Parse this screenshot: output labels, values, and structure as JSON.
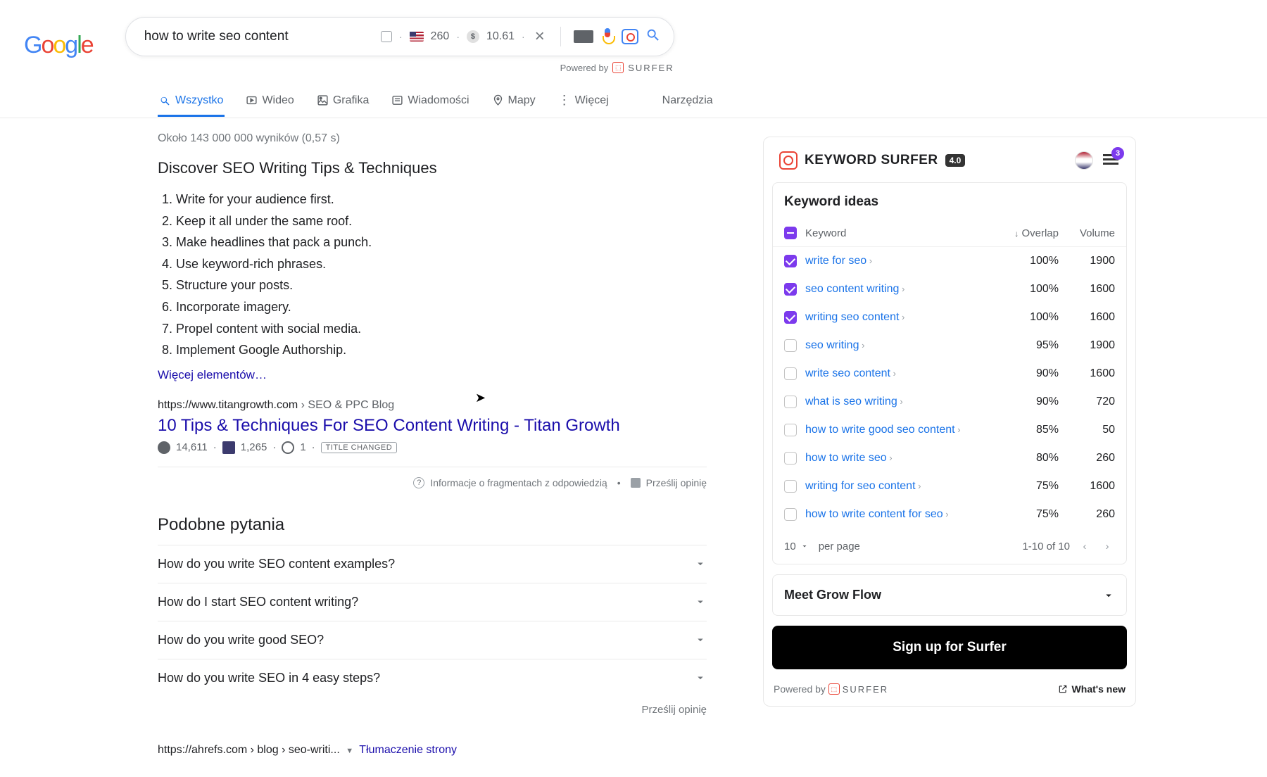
{
  "search": {
    "query": "how to write seo content",
    "volume": "260",
    "cpc": "10.61",
    "powered_by": "Powered by",
    "surfer": "SURFER"
  },
  "tabs": {
    "all": "Wszystko",
    "video": "Wideo",
    "graphics": "Grafika",
    "news": "Wiadomości",
    "maps": "Mapy",
    "more": "Więcej",
    "tools": "Narzędzia"
  },
  "stats": "Około 143 000 000 wyników (0,57 s)",
  "snippet": {
    "title": "Discover SEO Writing Tips & Techniques",
    "items": [
      "Write for your audience first.",
      "Keep it all under the same roof.",
      "Make headlines that pack a punch.",
      "Use keyword-rich phrases.",
      "Structure your posts.",
      "Incorporate imagery.",
      "Propel content with social media.",
      "Implement Google Authorship."
    ],
    "more": "Więcej elementów…"
  },
  "result1": {
    "url_host": "https://www.titangrowth.com",
    "url_path": " › SEO & PPC Blog",
    "title": "10 Tips & Techniques For SEO Content Writing - Titan Growth",
    "stat1": "14,611",
    "stat2": "1,265",
    "stat3": "1",
    "badge": "TITLE CHANGED"
  },
  "snippet_footer": {
    "info": "Informacje o fragmentach z odpowiedzią",
    "feedback": "Prześlij opinię"
  },
  "paa": {
    "title": "Podobne pytania",
    "items": [
      "How do you write SEO content examples?",
      "How do I start SEO content writing?",
      "How do you write good SEO?",
      "How do you write SEO in 4 easy steps?"
    ],
    "feedback": "Prześlij opinię"
  },
  "result2": {
    "url_host": "https://ahrefs.com",
    "url_path": " › blog › seo-writi...",
    "translate": "Tłumaczenie strony"
  },
  "ks": {
    "title": "KEYWORD SURFER",
    "version": "4.0",
    "filter_badge": "3",
    "ideas_title": "Keyword ideas",
    "col_keyword": "Keyword",
    "col_overlap": "Overlap",
    "col_volume": "Volume",
    "keywords": [
      {
        "kw": "write for seo",
        "overlap": "100%",
        "volume": "1900",
        "checked": true
      },
      {
        "kw": "seo content writing",
        "overlap": "100%",
        "volume": "1600",
        "checked": true
      },
      {
        "kw": "writing seo content",
        "overlap": "100%",
        "volume": "1600",
        "checked": true
      },
      {
        "kw": "seo writing",
        "overlap": "95%",
        "volume": "1900",
        "checked": false
      },
      {
        "kw": "write seo content",
        "overlap": "90%",
        "volume": "1600",
        "checked": false
      },
      {
        "kw": "what is seo writing",
        "overlap": "90%",
        "volume": "720",
        "checked": false
      },
      {
        "kw": "how to write good seo content",
        "overlap": "85%",
        "volume": "50",
        "checked": false
      },
      {
        "kw": "how to write seo",
        "overlap": "80%",
        "volume": "260",
        "checked": false
      },
      {
        "kw": "writing for seo content",
        "overlap": "75%",
        "volume": "1600",
        "checked": false
      },
      {
        "kw": "how to write content for seo",
        "overlap": "75%",
        "volume": "260",
        "checked": false
      }
    ],
    "per_page_val": "10",
    "per_page_label": "per page",
    "range": "1-10 of 10",
    "grow": "Meet Grow Flow",
    "signup": "Sign up for Surfer",
    "powered": "Powered by",
    "surfer": "SURFER",
    "whatsnew": "What's new"
  }
}
